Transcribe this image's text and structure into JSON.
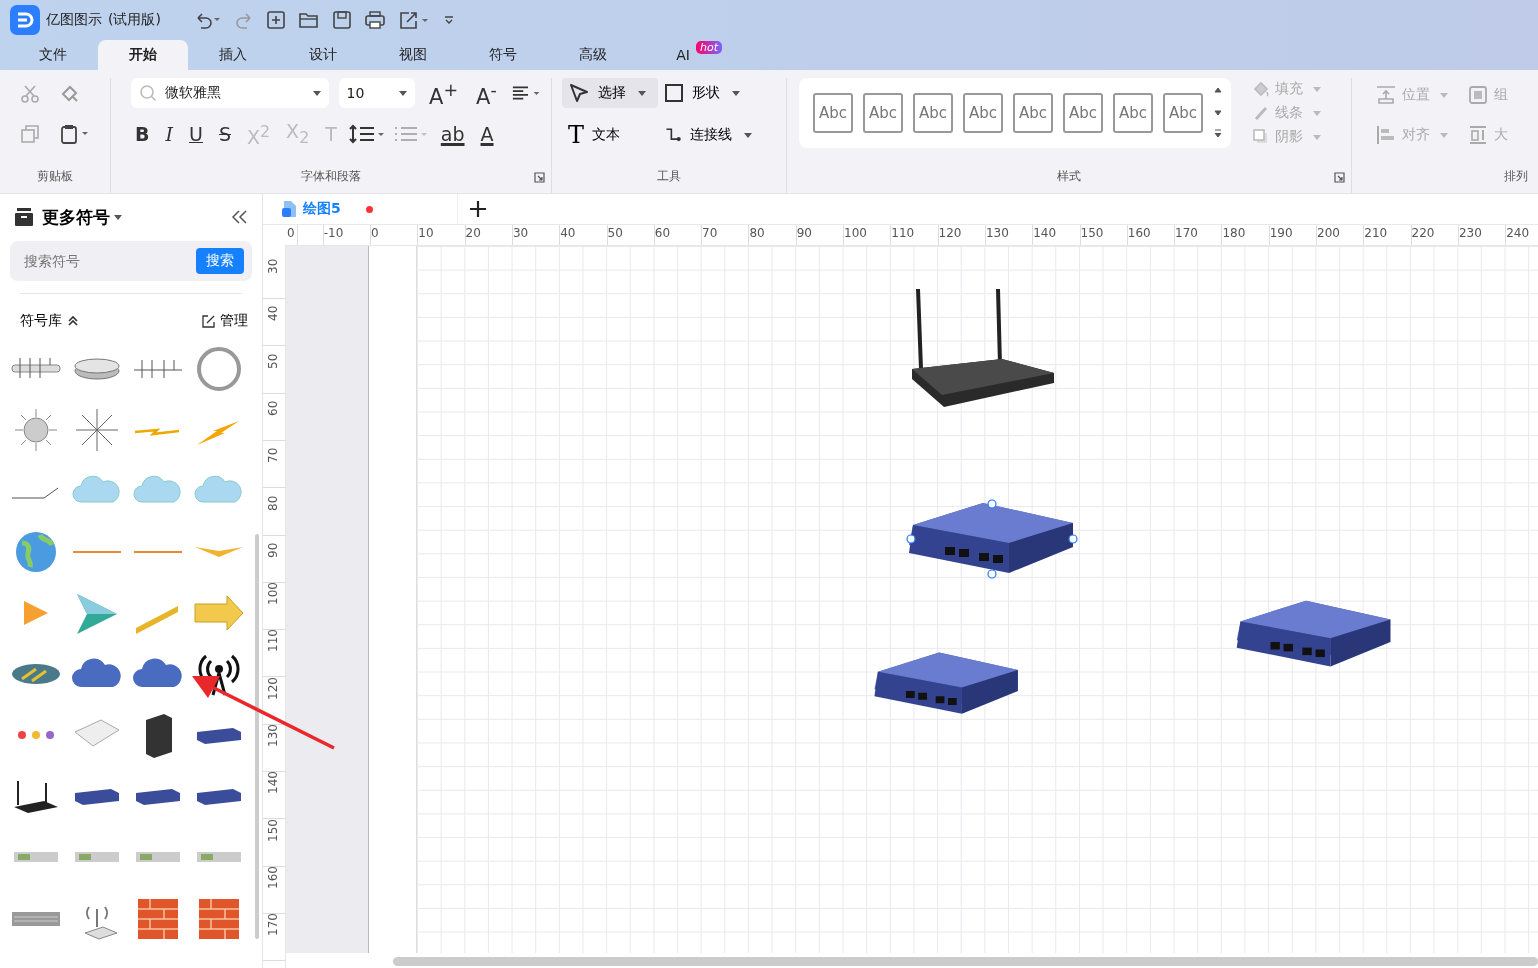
{
  "app": {
    "title": "亿图图示",
    "edition": "(试用版)"
  },
  "menu_tabs": [
    {
      "label": "文件",
      "selected": false
    },
    {
      "label": "开始",
      "selected": true
    },
    {
      "label": "插入",
      "selected": false
    },
    {
      "label": "设计",
      "selected": false
    },
    {
      "label": "视图",
      "selected": false
    },
    {
      "label": "符号",
      "selected": false
    },
    {
      "label": "高级",
      "selected": false
    },
    {
      "label": "AI",
      "selected": false,
      "badge": "hot"
    }
  ],
  "ribbon": {
    "clipboard": {
      "label": "剪贴板"
    },
    "font": {
      "family": "微软雅黑",
      "size": "10",
      "grow": "A$^{+}$",
      "shrink": "A$^{-}$",
      "label": "字体和段落",
      "format_buttons": [
        {
          "kind": "bold",
          "label": "B",
          "disabled": false
        },
        {
          "kind": "italic",
          "label": "I",
          "disabled": false
        },
        {
          "kind": "underline",
          "label": "U",
          "disabled": false
        },
        {
          "kind": "strike",
          "label": "S",
          "disabled": false
        },
        {
          "kind": "super",
          "label": "X$^{2}$",
          "disabled": true
        },
        {
          "kind": "sub",
          "label": "X$_{2}$",
          "disabled": true
        },
        {
          "kind": "textstyle",
          "label": "T",
          "disabled": true
        },
        {
          "kind": "spacing",
          "disabled": false
        },
        {
          "kind": "bullets",
          "disabled": true
        },
        {
          "kind": "highlight",
          "label": "ab",
          "disabled": false
        },
        {
          "kind": "color",
          "label": "A",
          "disabled": false
        }
      ]
    },
    "tools": {
      "select": "选择",
      "shape": "形状",
      "text_icon": "T",
      "text": "文本",
      "connector": "连接线",
      "label": "工具"
    },
    "styles": {
      "swatches": [
        "Abc",
        "Abc",
        "Abc",
        "Abc",
        "Abc",
        "Abc",
        "Abc",
        "Abc"
      ],
      "fill": "填充",
      "line": "线条",
      "shadow": "阴影",
      "label": "样式"
    },
    "arrange": {
      "position": "位置",
      "group": "组",
      "align": "对齐",
      "size": "大",
      "label": "排列"
    }
  },
  "sidebar": {
    "title": "更多符号",
    "search": {
      "placeholder": "搜索符号",
      "button": "搜索"
    },
    "library": {
      "label": "符号库",
      "expanded": true,
      "manage": "管理"
    }
  },
  "document_tabs": [
    {
      "title": "绘图5",
      "modified": true,
      "selected": true
    }
  ],
  "ruler": {
    "horizontal": [
      "0",
      "-10",
      "0",
      "10",
      "20",
      "30",
      "40",
      "50",
      "60",
      "70",
      "80",
      "90",
      "100",
      "110",
      "120",
      "130",
      "140",
      "150",
      "160",
      "170",
      "180",
      "190",
      "200",
      "210",
      "220",
      "230",
      "240"
    ],
    "vertical": [
      "30",
      "40",
      "50",
      "60",
      "70",
      "80",
      "90",
      "100",
      "110",
      "120",
      "130",
      "140",
      "150",
      "160",
      "170"
    ]
  },
  "canvas": {
    "shapes": [
      {
        "kind": "router",
        "selected": false
      },
      {
        "kind": "switch",
        "selected": true
      },
      {
        "kind": "switch",
        "selected": false
      },
      {
        "kind": "switch",
        "selected": false
      }
    ]
  }
}
